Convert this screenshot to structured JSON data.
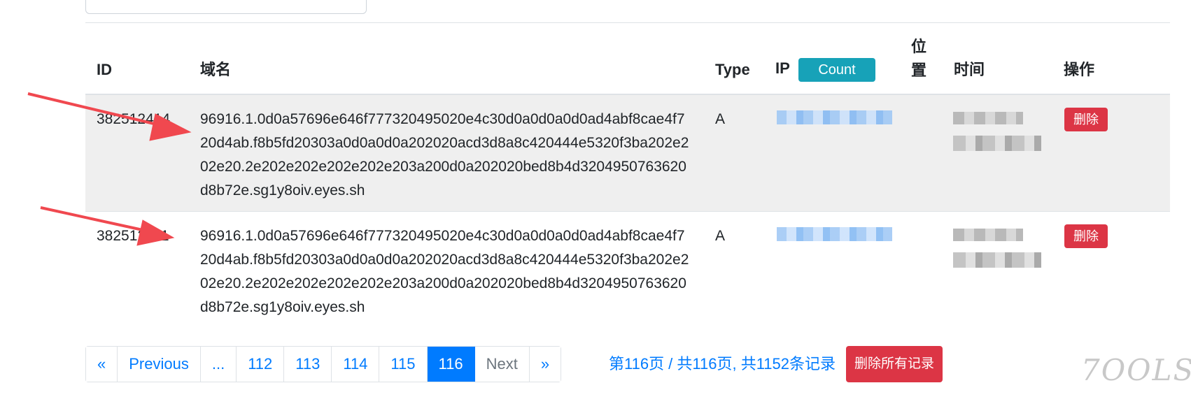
{
  "table": {
    "headers": {
      "id": "ID",
      "domain": "域名",
      "type": "Type",
      "ip": "IP",
      "count_badge": "Count",
      "position": "位置",
      "time": "时间",
      "action": "操作"
    },
    "rows": [
      {
        "id": "382512414",
        "domain": "96916.1.0d0a57696e646f777320495020e4c30d0a0d0a0d0ad4abf8cae4f720d4ab.f8b5fd20303a0d0a0d0a202020acd3d8a8c420444e5320f3ba202e202e20.2e202e202e202e202e203a200d0a202020bed8b4d3204950763620d8b72e.sg1y8oiv.eyes.sh",
        "type": "A",
        "delete_label": "删除"
      },
      {
        "id": "382512411",
        "domain": "96916.1.0d0a57696e646f777320495020e4c30d0a0d0a0d0ad4abf8cae4f720d4ab.f8b5fd20303a0d0a0d0a202020acd3d8a8c420444e5320f3ba202e202e20.2e202e202e202e202e203a200d0a202020bed8b4d3204950763620d8b72e.sg1y8oiv.eyes.sh",
        "type": "A",
        "delete_label": "删除"
      }
    ]
  },
  "pagination": {
    "first": "«",
    "previous": "Previous",
    "ellipsis": "...",
    "pages": [
      "112",
      "113",
      "114",
      "115",
      "116"
    ],
    "active_page": "116",
    "next": "Next",
    "last": "»"
  },
  "summary": "第116页 / 共116页, 共1152条记录",
  "delete_all_label": "删除所有记录",
  "watermark": "7OOLS",
  "colors": {
    "primary": "#007bff",
    "danger": "#dc3545",
    "info": "#17a2b8",
    "arrow": "#f0484f"
  }
}
